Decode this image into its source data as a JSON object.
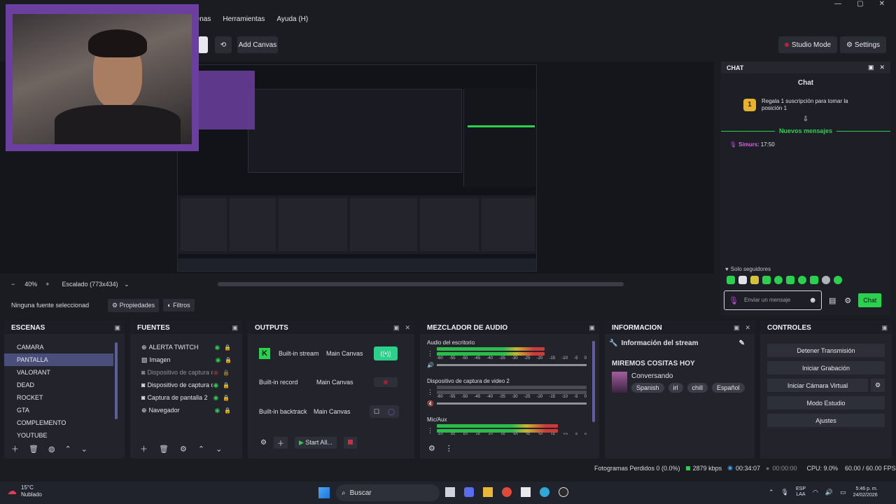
{
  "window": {
    "min": "—",
    "max": "▢",
    "close": "✕"
  },
  "menu": [
    "Escenas",
    "Herramientas",
    "Ayuda (H)"
  ],
  "toolbar": {
    "add_canvas": "Add Canvas",
    "studio_mode": "Studio Mode",
    "settings": "Settings"
  },
  "zoom": {
    "minus": "−",
    "value": "40%",
    "plus": "+",
    "scale": "Escalado (773x434)"
  },
  "sources_bar": {
    "none_selected": "Ninguna fuente seleccionad",
    "properties": "Propiedades",
    "filters": "Filtros"
  },
  "scenes": {
    "title": "ESCENAS",
    "items": [
      "CAMARA",
      "PANTALLA",
      "VALORANT",
      "DEAD",
      "ROCKET",
      "GTA",
      "COMPLEMENTO",
      "YOUTUBE"
    ],
    "selected_index": 1
  },
  "sources": {
    "title": "FUENTES",
    "items": [
      "ALERTA TWITCH",
      "Imagen",
      "Dispositivo de captura de",
      "Dispositivo de captura de",
      "Captura de pantalla 2",
      "Navegador"
    ]
  },
  "outputs": {
    "title": "OUTPUTS",
    "rows": [
      {
        "name": "Built-in stream",
        "canvas": "Main Canvas"
      },
      {
        "name": "Built-in record",
        "canvas": "Main Canvas"
      },
      {
        "name": "Built-in backtrack",
        "canvas": "Main Canvas"
      }
    ],
    "start_all": "Start All..."
  },
  "mixer": {
    "title": "MEZCLADOR DE AUDIO",
    "channels": [
      {
        "name": "Audio del escritorio",
        "level": 0.72
      },
      {
        "name": "Dispositivo de captura de video 2",
        "level": 0.0
      },
      {
        "name": "Mic/Aux",
        "level": 0.81
      }
    ],
    "ticks": [
      "-60",
      "-55",
      "-50",
      "-45",
      "-40",
      "-35",
      "-30",
      "-25",
      "-20",
      "-15",
      "-10",
      "-5",
      "0"
    ]
  },
  "info": {
    "title": "INFORMACION",
    "header": "Información del stream",
    "stream_title": "MIREMOS COSITAS HOY",
    "category": "Conversando",
    "tags": [
      "Spanish",
      "irl",
      "chill",
      "Español"
    ]
  },
  "controls": {
    "title": "CONTROLES",
    "buttons": [
      "Detener Transmisión",
      "Iniciar Grabación",
      "Iniciar Cámara Virtual",
      "Modo Estudio",
      "Ajustes"
    ]
  },
  "chat": {
    "dock_title": "CHAT",
    "title": "Chat",
    "gift_text": "Regala 1 suscripción para tomar la posición 1",
    "gift_rank": "1",
    "new_messages": "Nuevos mensajes",
    "message": {
      "user": "Simurs",
      "text": ": 17:50"
    },
    "followers_only": "Solo seguidores",
    "input_placeholder": "Enviar un mensaje",
    "send": "Chat"
  },
  "status": {
    "dropped": "Fotogramas Perdidos 0 (0.0%)",
    "bitrate": "2879 kbps",
    "stream_time": "00:34:07",
    "record_time": "00:00:00",
    "cpu": "CPU: 9.0%",
    "fps": "60.00 / 60.00 FPS"
  },
  "taskbar": {
    "temp": "15°C",
    "weather": "Nublado",
    "search": "Buscar",
    "lang": "ESP",
    "lang2": "LAA",
    "time": "5:46 p. m.",
    "date": "24/02/2026"
  },
  "colors": {
    "accent": "#4a4e7a",
    "green": "#2bd04e",
    "purple": "#6b3fa0"
  }
}
